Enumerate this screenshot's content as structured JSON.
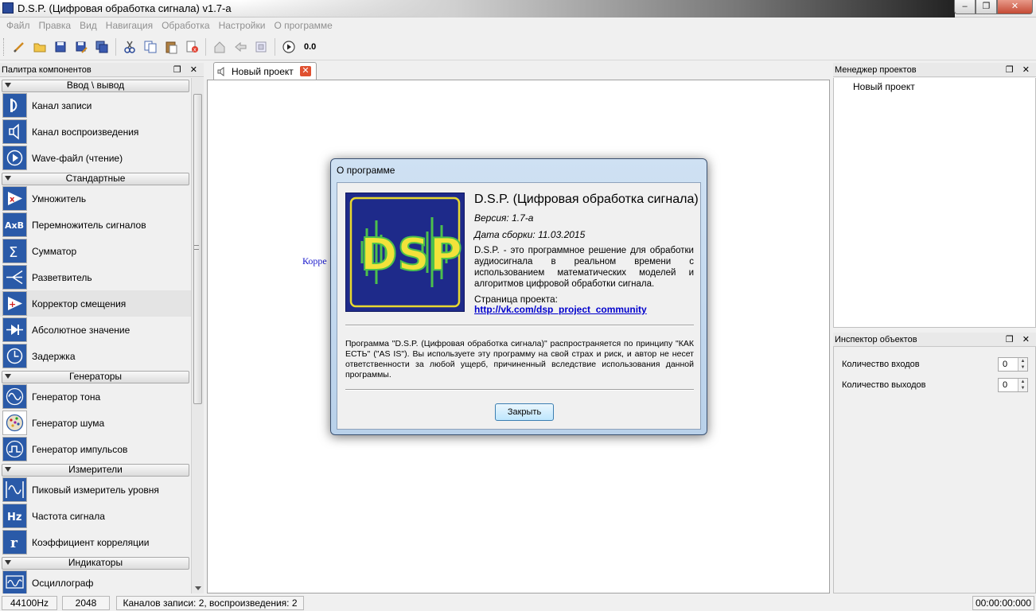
{
  "window": {
    "title": "D.S.P. (Цифровая обработка сигнала) v1.7-a",
    "controls": [
      "–",
      "❐",
      "✕"
    ]
  },
  "menu": [
    "Файл",
    "Правка",
    "Вид",
    "Навигация",
    "Обработка",
    "Настройки",
    "О программе"
  ],
  "toolbar": {
    "counter": "0.0"
  },
  "palette": {
    "title": "Палитра компонентов",
    "header_buttons": "❐ ✕",
    "categories": [
      {
        "name": "Ввод \\ вывод",
        "items": [
          "Канал записи",
          "Канал воспроизведения",
          "Wave-файл (чтение)"
        ]
      },
      {
        "name": "Стандартные",
        "items": [
          "Умножитель",
          "Перемножитель сигналов",
          "Сумматор",
          "Разветвитель",
          "Корректор смещения",
          "Абсолютное значение",
          "Задержка"
        ]
      },
      {
        "name": "Генераторы",
        "items": [
          "Генератор тона",
          "Генератор шума",
          "Генератор импульсов"
        ]
      },
      {
        "name": "Измерители",
        "items": [
          "Пиковый измеритель уровня",
          "Частота сигнала",
          "Коэффициент корреляции"
        ]
      },
      {
        "name": "Индикаторы",
        "items": [
          "Осциллограф"
        ]
      }
    ]
  },
  "editor": {
    "tab_label": "Новый проект",
    "canvas_label": "Корре"
  },
  "projects": {
    "title": "Менеджер проектов",
    "header_buttons": "❐ ✕",
    "item": "Новый проект"
  },
  "inspector": {
    "title": "Инспектор объектов",
    "header_buttons": "❐ ✕",
    "inputs_label": "Количество входов",
    "inputs_value": "0",
    "outputs_label": "Количество выходов",
    "outputs_value": "0"
  },
  "statusbar": {
    "sample_rate": "44100Hz",
    "buffer": "2048",
    "channels": "Каналов записи: 2, воспроизведения: 2",
    "time": "00:00:00:000"
  },
  "dialog": {
    "title": "О программе",
    "logo_text": "DSP",
    "app_name": "D.S.P. (Цифровая обработка сигнала)",
    "version": "Версия: 1.7-a",
    "build_date": "Дата сборки: 11.03.2015",
    "description": "D.S.P. - это программное решение для обработки аудиосигнала в реальном времени с использованием математических моделей и алгоритмов цифровой обработки сигнала.",
    "page_label": "Страница проекта:",
    "page_link": "http://vk.com/dsp_project_community",
    "license": "Программа \"D.S.P. (Цифровая обработка сигнала)\" распространяется по принципу \"КАК ЕСТЬ\" (\"AS IS\"). Вы используете эту программу на свой страх и риск, и автор не несет ответственности за любой ущерб, причиненный вследствие использования данной программы.",
    "close_label": "Закрыть"
  },
  "colors": {
    "accent": "#2a4a9a",
    "link": "#0000cc",
    "logo_bg": "#1e2a8a",
    "logo_text": "#f2e23a",
    "logo_wave": "#4cc04c"
  }
}
